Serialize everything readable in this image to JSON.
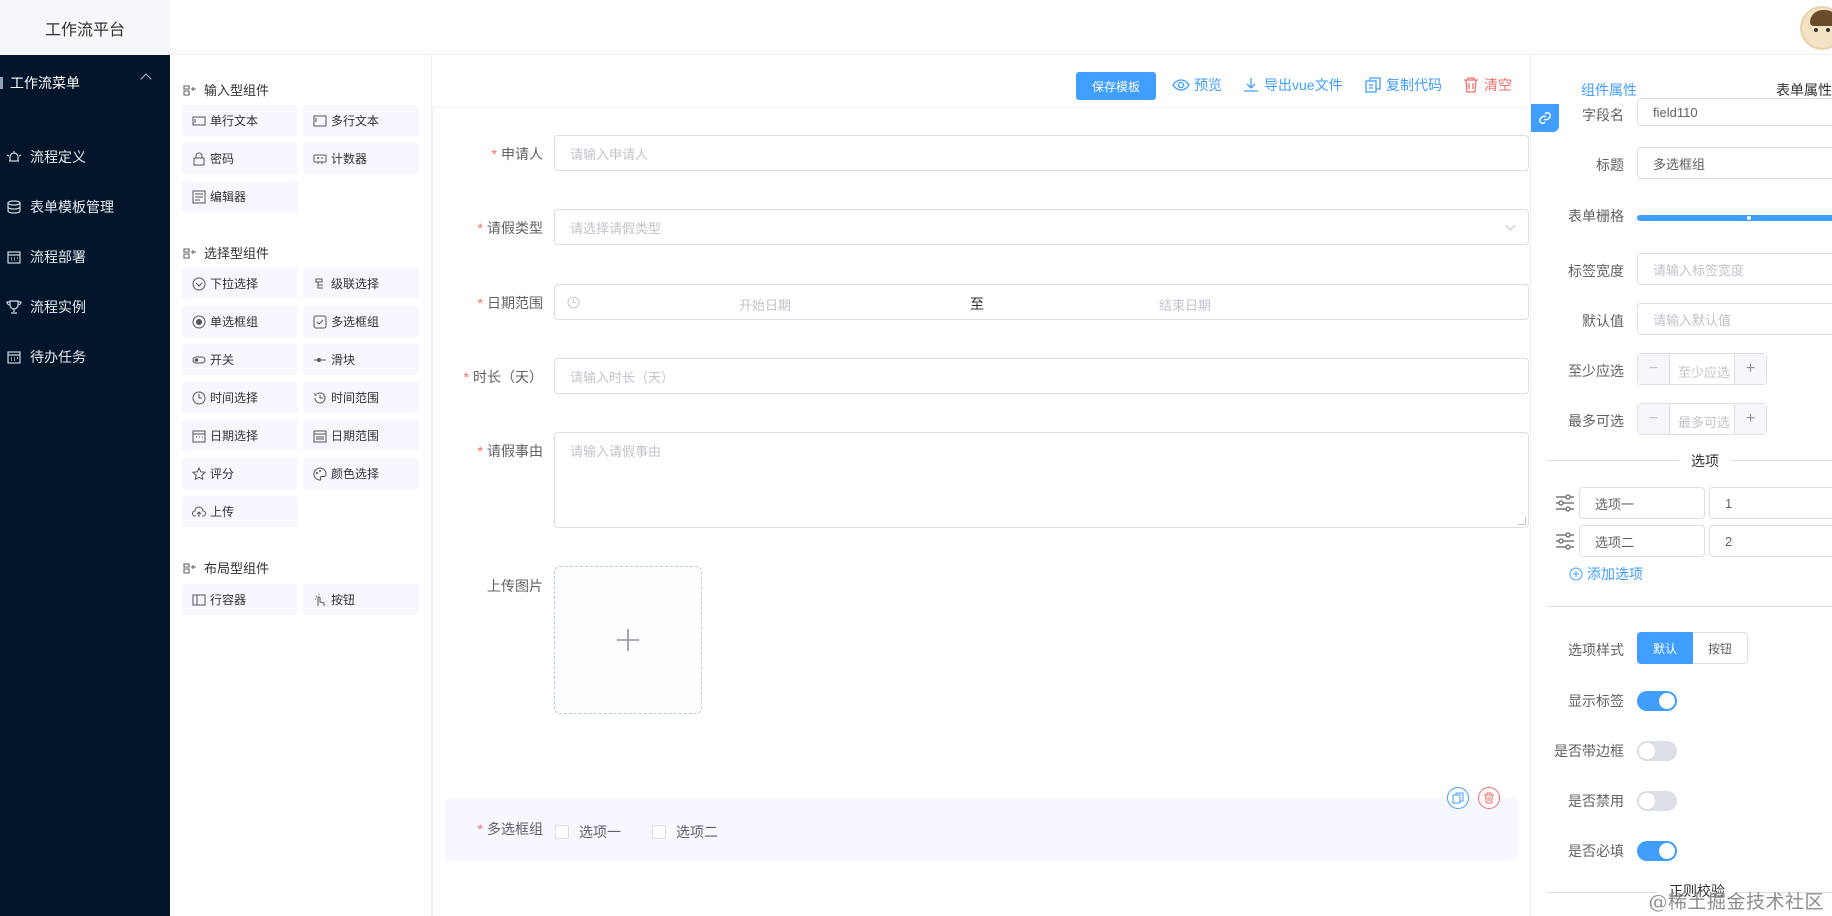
{
  "app": {
    "title": "工作流平台"
  },
  "sidebar": {
    "group_label": "工作流菜单",
    "items": [
      {
        "label": "流程定义",
        "icon": "bell-icon"
      },
      {
        "label": "表单模板管理",
        "icon": "database-icon"
      },
      {
        "label": "流程部署",
        "icon": "calendar-icon"
      },
      {
        "label": "流程实例",
        "icon": "trophy-icon"
      },
      {
        "label": "待办任务",
        "icon": "calendar-check-icon"
      }
    ]
  },
  "palette": {
    "input_group": "输入型组件",
    "input_items": [
      "单行文本",
      "多行文本",
      "密码",
      "计数器",
      "编辑器"
    ],
    "select_group": "选择型组件",
    "select_items": [
      "下拉选择",
      "级联选择",
      "单选框组",
      "多选框组",
      "开关",
      "滑块",
      "时间选择",
      "时间范围",
      "日期选择",
      "日期范围",
      "评分",
      "颜色选择",
      "上传"
    ],
    "layout_group": "布局型组件",
    "layout_items": [
      "行容器",
      "按钮"
    ]
  },
  "toolbar": {
    "save": "保存模板",
    "preview": "预览",
    "export": "导出vue文件",
    "copy": "复制代码",
    "clear": "清空"
  },
  "form": {
    "applicant": {
      "label": "申请人",
      "placeholder": "请输入申请人"
    },
    "leave_type": {
      "label": "请假类型",
      "placeholder": "请选择请假类型"
    },
    "date_range": {
      "label": "日期范围",
      "start": "开始日期",
      "separator": "至",
      "end": "结束日期"
    },
    "duration": {
      "label": "时长（天）",
      "placeholder": "请输入时长（天）"
    },
    "reason": {
      "label": "请假事由",
      "placeholder": "请输入请假事由"
    },
    "upload": {
      "label": "上传图片"
    },
    "checkbox_group": {
      "label": "多选框组",
      "options": [
        "选项一",
        "选项二"
      ]
    }
  },
  "props_panel": {
    "tab_component": "组件属性",
    "tab_form": "表单属性",
    "field_name": {
      "label": "字段名",
      "value": "field110"
    },
    "title": {
      "label": "标题",
      "value": "多选框组"
    },
    "grid": {
      "label": "表单栅格"
    },
    "label_width": {
      "label": "标签宽度",
      "placeholder": "请输入标签宽度"
    },
    "default_value": {
      "label": "默认值",
      "placeholder": "请输入默认值"
    },
    "min": {
      "label": "至少应选",
      "placeholder": "至少应选"
    },
    "max": {
      "label": "最多可选",
      "placeholder": "最多可选"
    },
    "options_divider": "选项",
    "options": [
      {
        "label": "选项一",
        "value": "1"
      },
      {
        "label": "选项二",
        "value": "2"
      }
    ],
    "add_option": "添加选项",
    "option_style": {
      "label": "选项样式",
      "default": "默认",
      "button": "按钮"
    },
    "show_label": {
      "label": "显示标签",
      "on": true
    },
    "border": {
      "label": "是否带边框",
      "on": false
    },
    "disabled": {
      "label": "是否禁用",
      "on": false
    },
    "required": {
      "label": "是否必填",
      "on": true
    },
    "regex_divider": "正则校验"
  },
  "watermark": "@稀土掘金技术社区",
  "colors": {
    "primary": "#409eff",
    "danger": "#f56c6c",
    "sidebar": "#03152b"
  }
}
